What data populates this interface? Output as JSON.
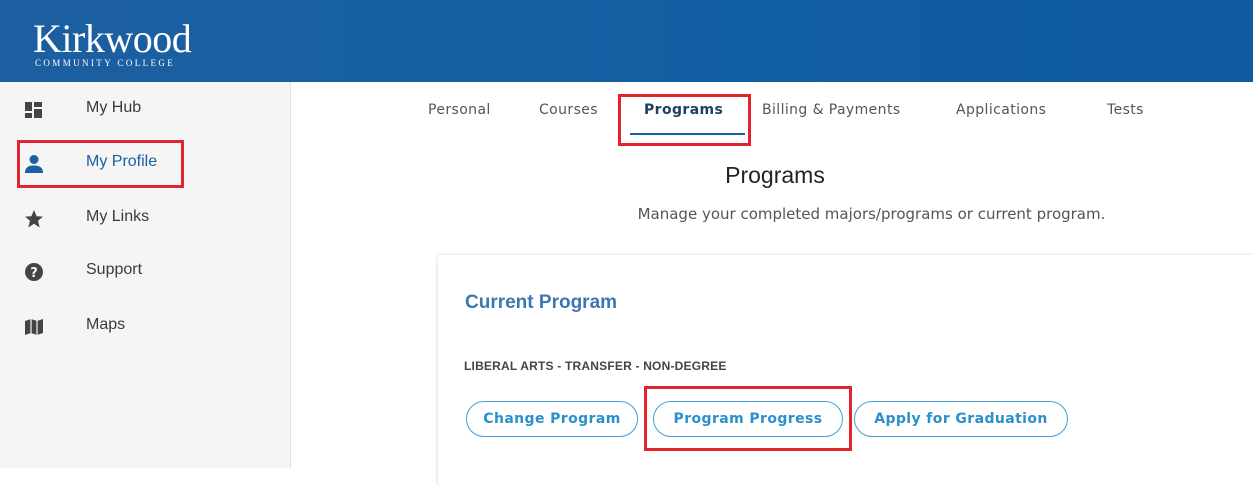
{
  "header": {
    "logo_text": "Kirkwood",
    "logo_subtext": "COMMUNITY COLLEGE"
  },
  "sidebar": {
    "items": [
      {
        "label": "My Hub",
        "icon": "dashboard-grid-icon"
      },
      {
        "label": "My Profile",
        "icon": "person-icon",
        "active": true
      },
      {
        "label": "My Links",
        "icon": "star-icon"
      },
      {
        "label": "Support",
        "icon": "help-circle-icon"
      },
      {
        "label": "Maps",
        "icon": "map-icon"
      }
    ]
  },
  "tabs": [
    {
      "label": "Personal"
    },
    {
      "label": "Courses"
    },
    {
      "label": "Programs",
      "active": true
    },
    {
      "label": "Billing & Payments"
    },
    {
      "label": "Applications"
    },
    {
      "label": "Tests"
    }
  ],
  "main": {
    "title": "Programs",
    "subtitle": "Manage your completed majors/programs or current program.",
    "card": {
      "heading": "Current Program",
      "program_name": "LIBERAL ARTS - TRANSFER - NON-DEGREE",
      "buttons": {
        "change": "Change Program",
        "progress": "Program Progress",
        "graduation": "Apply for Graduation"
      }
    }
  },
  "colors": {
    "header_blue": "#1460a3",
    "accent_blue": "#3c78b0",
    "button_blue": "#2b8fcc",
    "highlight_red": "#e0232e",
    "sidebar_bg": "#f5f5f5"
  }
}
